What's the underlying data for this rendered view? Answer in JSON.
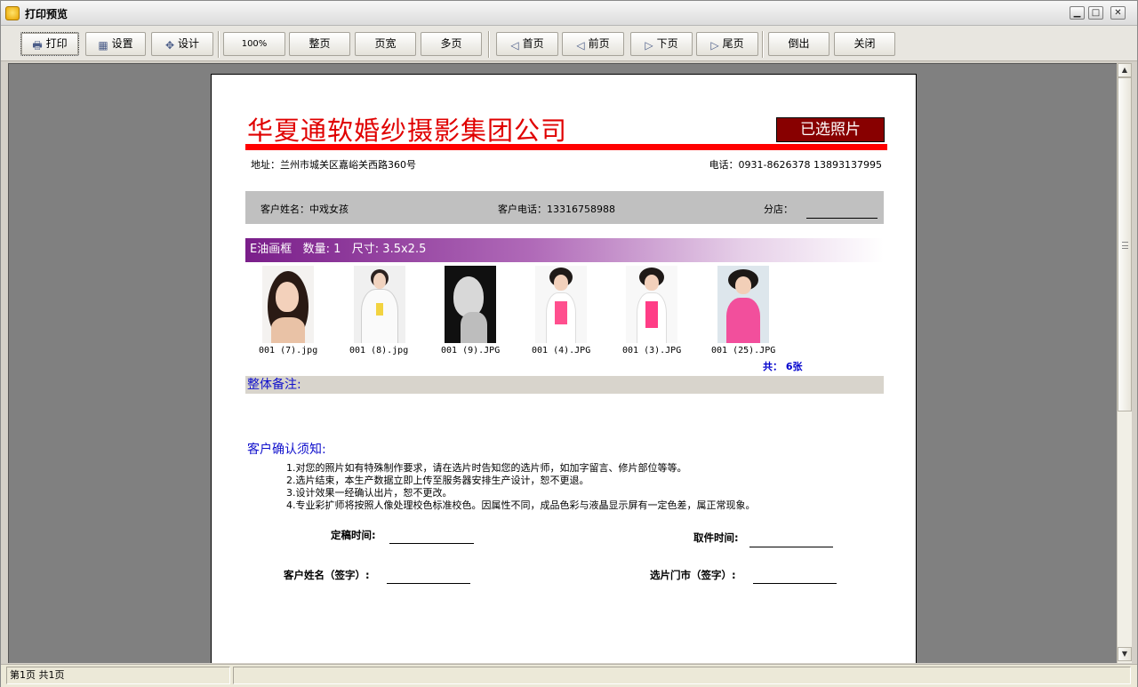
{
  "window": {
    "title": "打印预览",
    "min": "▁",
    "max": "□",
    "close": "✕"
  },
  "toolbar": {
    "print": "打印",
    "settings": "设置",
    "design": "设计",
    "zoom100": "100%",
    "whole_page": "整页",
    "page_width": "页宽",
    "multi_page": "多页",
    "first": "首页",
    "prev": "前页",
    "next": "下页",
    "last": "尾页",
    "export": "倒出",
    "close": "关闭"
  },
  "status": {
    "page_info": "第1页 共1页"
  },
  "report": {
    "company": "华夏通软婚纱摄影集团公司",
    "badge": "已选照片",
    "address": "地址：兰州市城关区嘉峪关西路360号",
    "phone": "电话：0931-8626378 13893137995",
    "customer_name": "客户姓名：中戏女孩",
    "customer_phone": "客户电话：13316758988",
    "branch": "分店：",
    "product": "E油画框   数量: 1   尺寸: 3.5x2.5",
    "photos": [
      {
        "file": "001 (7).jpg"
      },
      {
        "file": "001 (8).jpg"
      },
      {
        "file": "001 (9).JPG"
      },
      {
        "file": "001 (4).JPG"
      },
      {
        "file": "001 (3).JPG"
      },
      {
        "file": "001 (25).JPG"
      }
    ],
    "total": "共：  6张",
    "remark": "整体备注:",
    "notice_title": "客户确认须知:",
    "notices": [
      "1.对您的照片如有特殊制作要求，请在选片时告知您的选片师，如加字留言、修片部位等等。",
      "2.选片结束，本生产数据立即上传至服务器安排生产设计，恕不更退。",
      "3.设计效果一经确认出片，恕不更改。",
      "4.专业彩扩师将按照人像处理校色标准校色。因属性不同，成品色彩与液晶显示屏有一定色差，属正常现象。"
    ],
    "finalize_time": "定稿时间:",
    "pickup_time": "取件时间:",
    "customer_sign": "客户姓名（签字）:",
    "store_sign": "选片门市（签字）:"
  }
}
